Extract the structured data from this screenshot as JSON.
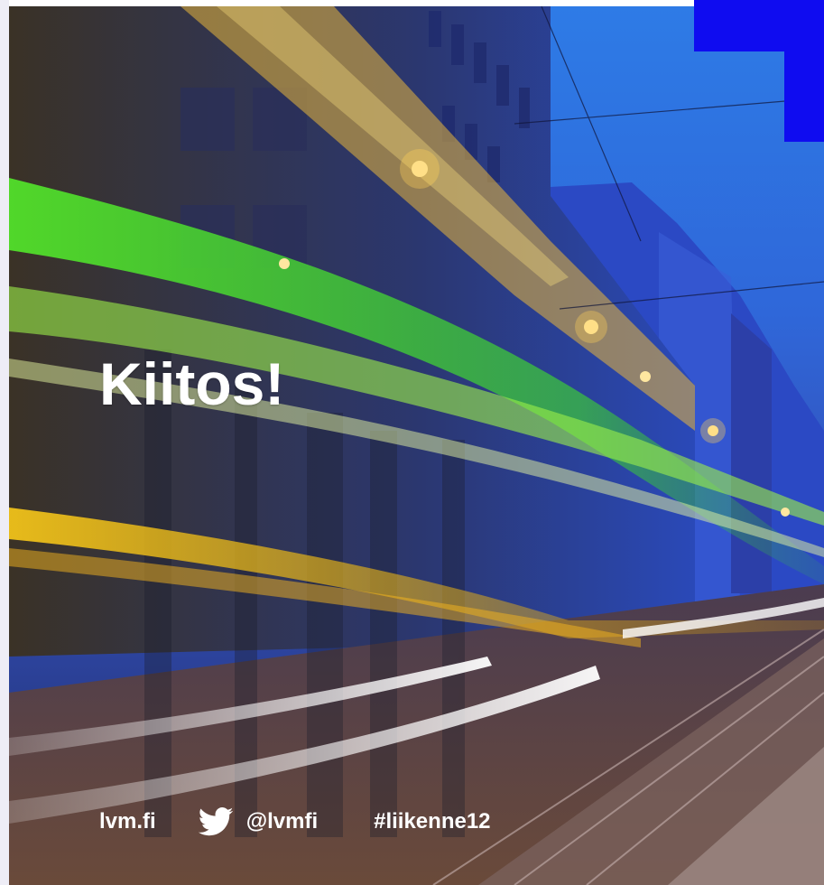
{
  "slide": {
    "title": "Kiitos!",
    "footer": {
      "website": "lvm.fi",
      "twitter_handle": "@lvmfi",
      "hashtag": "#liikenne12",
      "twitter_icon": "twitter-bird-icon"
    }
  },
  "colors": {
    "accent_blue": "#0f0cf0",
    "text": "#ffffff"
  }
}
